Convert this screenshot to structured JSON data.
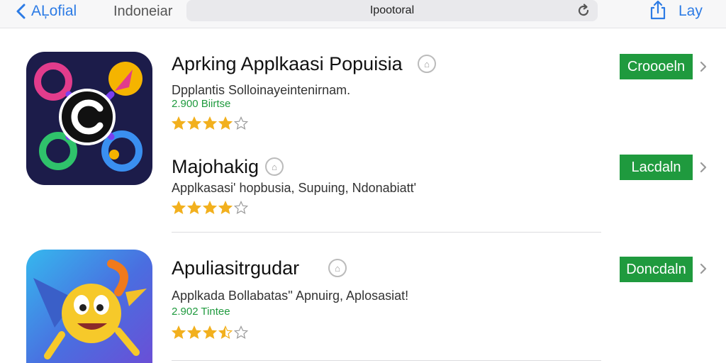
{
  "nav": {
    "back_label": "AĻofial",
    "crumb": "Indoneiar",
    "url": "Ipootoral",
    "share_label": "Lay"
  },
  "apps": [
    {
      "title": "Aprking Applkaasi Popuisia",
      "desc": "Dpplantis Solloinayeintenirnam.",
      "count": "2.900 Biirtse",
      "rating": 4,
      "button": "Croooeln"
    },
    {
      "title": "Majohakig",
      "desc": "Applkasasi' hopbusia, Supuing, Ndonabiatt'",
      "count": "",
      "rating": 4,
      "button": "Lacdaln"
    },
    {
      "title": "Apuliasitrgudar",
      "desc": "Applkada Bollabatas'' Apnuirg, Aplosasiat!",
      "count": "2.902 Tintee",
      "rating": 3.5,
      "button": "Doncdaln"
    }
  ],
  "colors": {
    "accent": "#2c7be5",
    "button_green": "#1f9a3e",
    "star": "#f2b01e"
  },
  "icons": [
    "back-chevron-icon",
    "reload-icon",
    "share-icon",
    "chevron-right-icon",
    "badge-icon",
    "star-icon"
  ]
}
